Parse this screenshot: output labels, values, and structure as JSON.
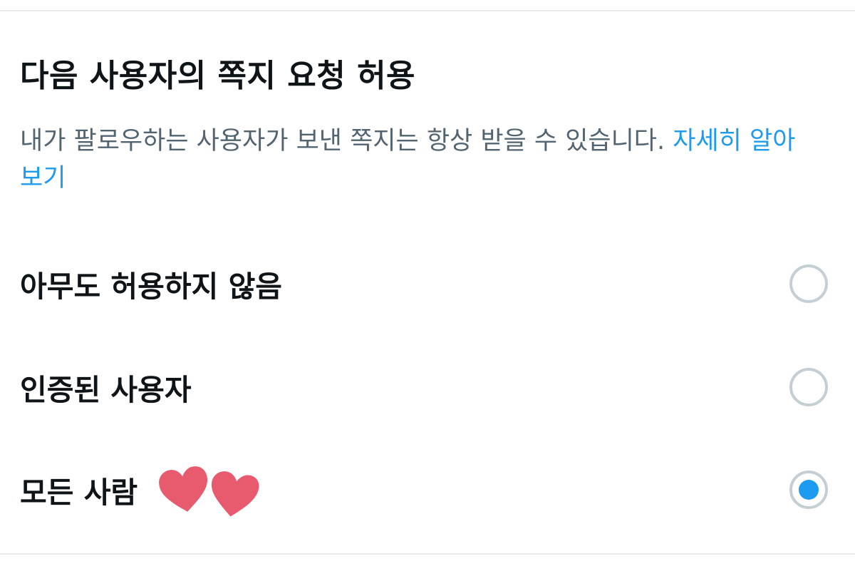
{
  "section": {
    "title": "다음 사용자의 쪽지 요청 허용",
    "description": "내가 팔로우하는 사용자가 보낸 쪽지는 항상 받을 수 있습니다.",
    "learn_more": "자세히 알아보기"
  },
  "options": [
    {
      "label": "아무도 허용하지 않음",
      "selected": false
    },
    {
      "label": "인증된 사용자",
      "selected": false
    },
    {
      "label": "모든 사람",
      "selected": true
    }
  ],
  "decorations": {
    "hearts": [
      "heart-icon",
      "heart-icon"
    ],
    "heart_color": "#e85a6e"
  },
  "colors": {
    "accent": "#1d9bf0",
    "text_primary": "#0f1419",
    "text_secondary": "#536471",
    "radio_border": "#c4ced5",
    "divider": "#e6e9ea"
  }
}
